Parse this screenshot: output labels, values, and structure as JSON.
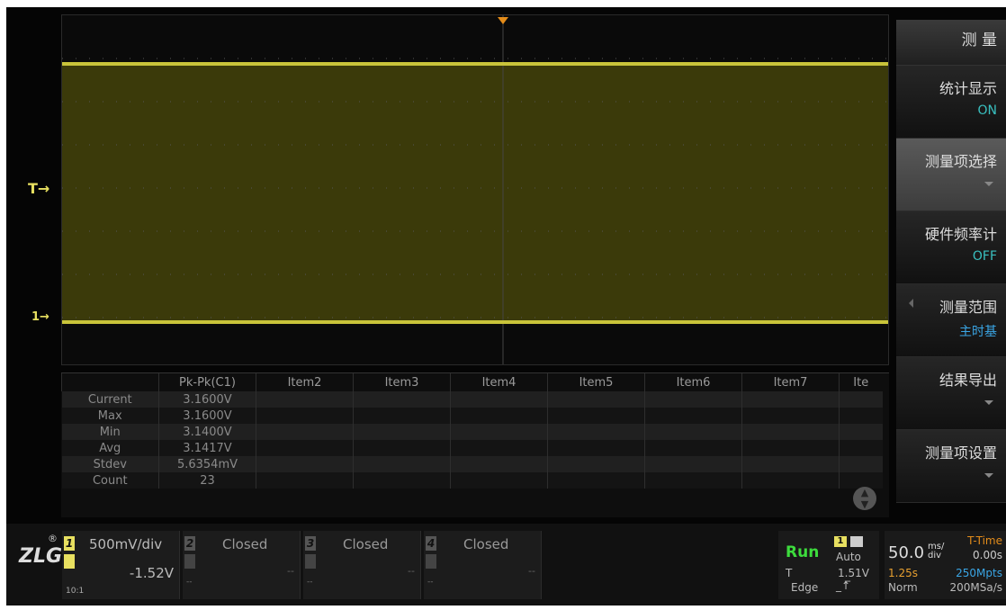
{
  "grid": {
    "trigger_marker": "T",
    "channel_marker": "1"
  },
  "measurements": {
    "headers": [
      "",
      "Pk-Pk(C1)",
      "Item2",
      "Item3",
      "Item4",
      "Item5",
      "Item6",
      "Item7",
      "Ite"
    ],
    "rows": [
      {
        "label": "Current",
        "value": "3.1600V"
      },
      {
        "label": "Max",
        "value": "3.1600V"
      },
      {
        "label": "Min",
        "value": "3.1400V"
      },
      {
        "label": "Avg",
        "value": "3.1417V"
      },
      {
        "label": "Stdev",
        "value": "5.6354mV"
      },
      {
        "label": "Count",
        "value": "23"
      }
    ]
  },
  "menu": {
    "title": "测 量",
    "items": [
      {
        "label": "统计显示",
        "value": "ON",
        "value_color": "#39c0c0"
      },
      {
        "label": "测量项选择",
        "value": "",
        "value_color": ""
      },
      {
        "label": "硬件频率计",
        "value": "OFF",
        "value_color": "#39c0c0"
      },
      {
        "label": "测量范围",
        "value": "主时基",
        "value_color": "#3aa6e6"
      },
      {
        "label": "结果导出",
        "value": "",
        "value_color": ""
      },
      {
        "label": "测量项设置",
        "value": "",
        "value_color": ""
      }
    ]
  },
  "bottom": {
    "logo": "ZLG",
    "reg": "®",
    "ch1": {
      "num": "1",
      "scale": "500mV/div",
      "offset": "-1.52V",
      "probe": "10:1",
      "color": "#e8e060"
    },
    "ch2": {
      "num": "2",
      "status": "Closed",
      "dash": "--"
    },
    "ch3": {
      "num": "3",
      "status": "Closed",
      "dash": "--"
    },
    "ch4": {
      "num": "4",
      "status": "Closed",
      "dash": "--"
    },
    "run": {
      "state": "Run",
      "mode": "Auto",
      "trig_label": "T",
      "trig_level": "1.51V",
      "trig_type": "Edge"
    },
    "timebase": {
      "scale": "50.0",
      "unit_top": "ms/",
      "unit_bottom": "div",
      "ttime_label": "T-Time",
      "ttime": "0.00s",
      "window": "1.25s",
      "points": "250Mpts",
      "trig_mode": "Norm",
      "rate": "200MSa/s"
    }
  }
}
